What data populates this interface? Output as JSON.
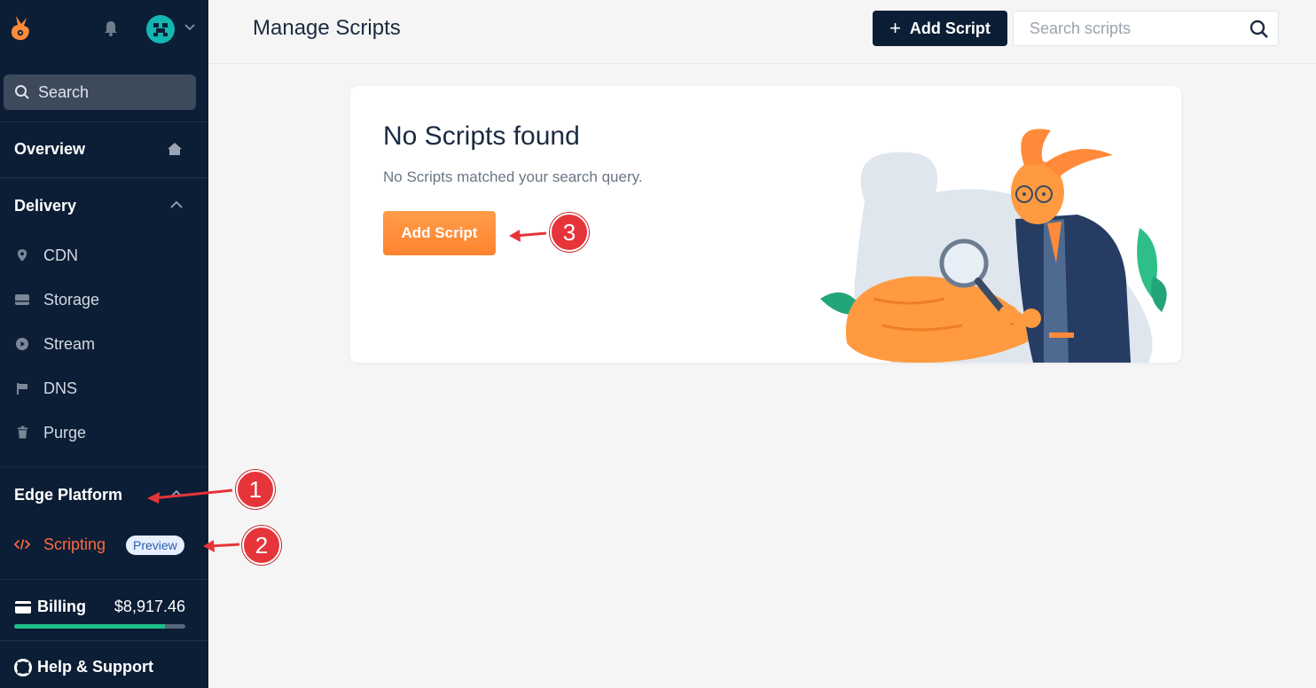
{
  "sidebar": {
    "search_label": "Search",
    "sections": {
      "overview": "Overview",
      "delivery": "Delivery",
      "edge_platform": "Edge Platform"
    },
    "delivery_items": [
      "CDN",
      "Storage",
      "Stream",
      "DNS",
      "Purge"
    ],
    "scripting_label": "Scripting",
    "preview_badge": "Preview",
    "billing_label": "Billing",
    "billing_amount": "$8,917.46",
    "billing_progress": 0.88,
    "help_label": "Help & Support"
  },
  "header": {
    "title": "Manage Scripts",
    "add_button": "Add Script",
    "search_placeholder": "Search scripts"
  },
  "empty_state": {
    "title": "No Scripts found",
    "subtitle": "No Scripts matched your search query.",
    "button": "Add Script"
  },
  "annotations": [
    "1",
    "2",
    "3"
  ],
  "colors": {
    "sidebar_bg": "#0c1e36",
    "accent_orange": "#ff8a3a",
    "active_item": "#ff6a3d",
    "marker_red": "#e5353a",
    "billing_bar": "#1fbf8a"
  }
}
